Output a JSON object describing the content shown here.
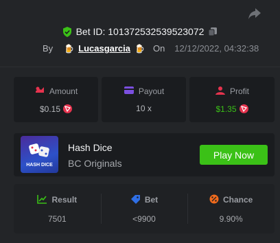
{
  "header": {
    "bet_id_label": "Bet ID: 101372532539523072",
    "by_label": "By",
    "username": "Lucasgarcia",
    "on_label": "On",
    "date": "12/12/2022, 04:32:38"
  },
  "stats": {
    "amount": {
      "label": "Amount",
      "value": "$0.15"
    },
    "payout": {
      "label": "Payout",
      "value": "10 x"
    },
    "profit": {
      "label": "Profit",
      "value": "$1.35"
    }
  },
  "game": {
    "thumb_text": "HASH DICE",
    "title": "Hash Dice",
    "provider": "BC Originals",
    "play_label": "Play Now"
  },
  "results": {
    "result": {
      "label": "Result",
      "value": "7501"
    },
    "bet": {
      "label": "Bet",
      "value": "<9900"
    },
    "chance": {
      "label": "Chance",
      "value": "9.90%"
    }
  },
  "colors": {
    "accent_green": "#3bc117",
    "coin_red": "#e6334e",
    "background": "#232528",
    "card": "#1a1c1f"
  }
}
